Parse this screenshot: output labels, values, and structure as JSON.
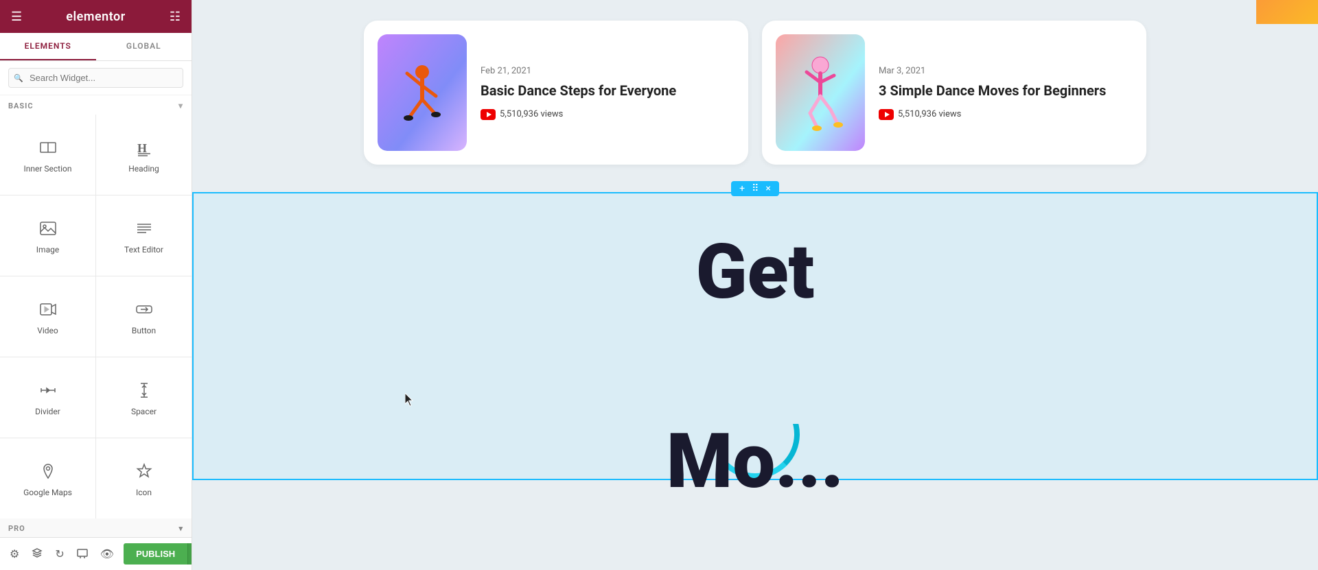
{
  "sidebar": {
    "logo": "elementor",
    "tabs": [
      {
        "label": "ELEMENTS",
        "active": true
      },
      {
        "label": "GLOBAL",
        "active": false
      }
    ],
    "search": {
      "placeholder": "Search Widget..."
    },
    "basic_section": "BASIC",
    "pro_section": "PRO",
    "widgets": [
      {
        "id": "inner-section",
        "label": "Inner Section",
        "icon": "inner-section-icon"
      },
      {
        "id": "heading",
        "label": "Heading",
        "icon": "heading-icon"
      },
      {
        "id": "image",
        "label": "Image",
        "icon": "image-icon"
      },
      {
        "id": "text-editor",
        "label": "Text Editor",
        "icon": "text-editor-icon"
      },
      {
        "id": "video",
        "label": "Video",
        "icon": "video-icon"
      },
      {
        "id": "button",
        "label": "Button",
        "icon": "button-icon"
      },
      {
        "id": "divider",
        "label": "Divider",
        "icon": "divider-icon"
      },
      {
        "id": "spacer",
        "label": "Spacer",
        "icon": "spacer-icon"
      },
      {
        "id": "google-maps",
        "label": "Google Maps",
        "icon": "google-maps-icon"
      },
      {
        "id": "icon",
        "label": "Icon",
        "icon": "icon-icon"
      }
    ],
    "bottom_icons": [
      "settings",
      "layers",
      "history",
      "responsive",
      "preview"
    ],
    "publish_label": "PUBLISH"
  },
  "main": {
    "cards": [
      {
        "id": "card1",
        "date": "Feb 21, 2021",
        "title": "Basic Dance Steps for Everyone",
        "views": "5,510,936 views",
        "image_style": "purple"
      },
      {
        "id": "card2",
        "date": "Mar 3, 2021",
        "title": "3 Simple Dance Moves for Beginners",
        "views": "5,510,936 views",
        "image_style": "pink"
      }
    ],
    "toolbar": {
      "add": "+",
      "move": "⠿",
      "close": "×"
    },
    "hero_text": "Get"
  }
}
